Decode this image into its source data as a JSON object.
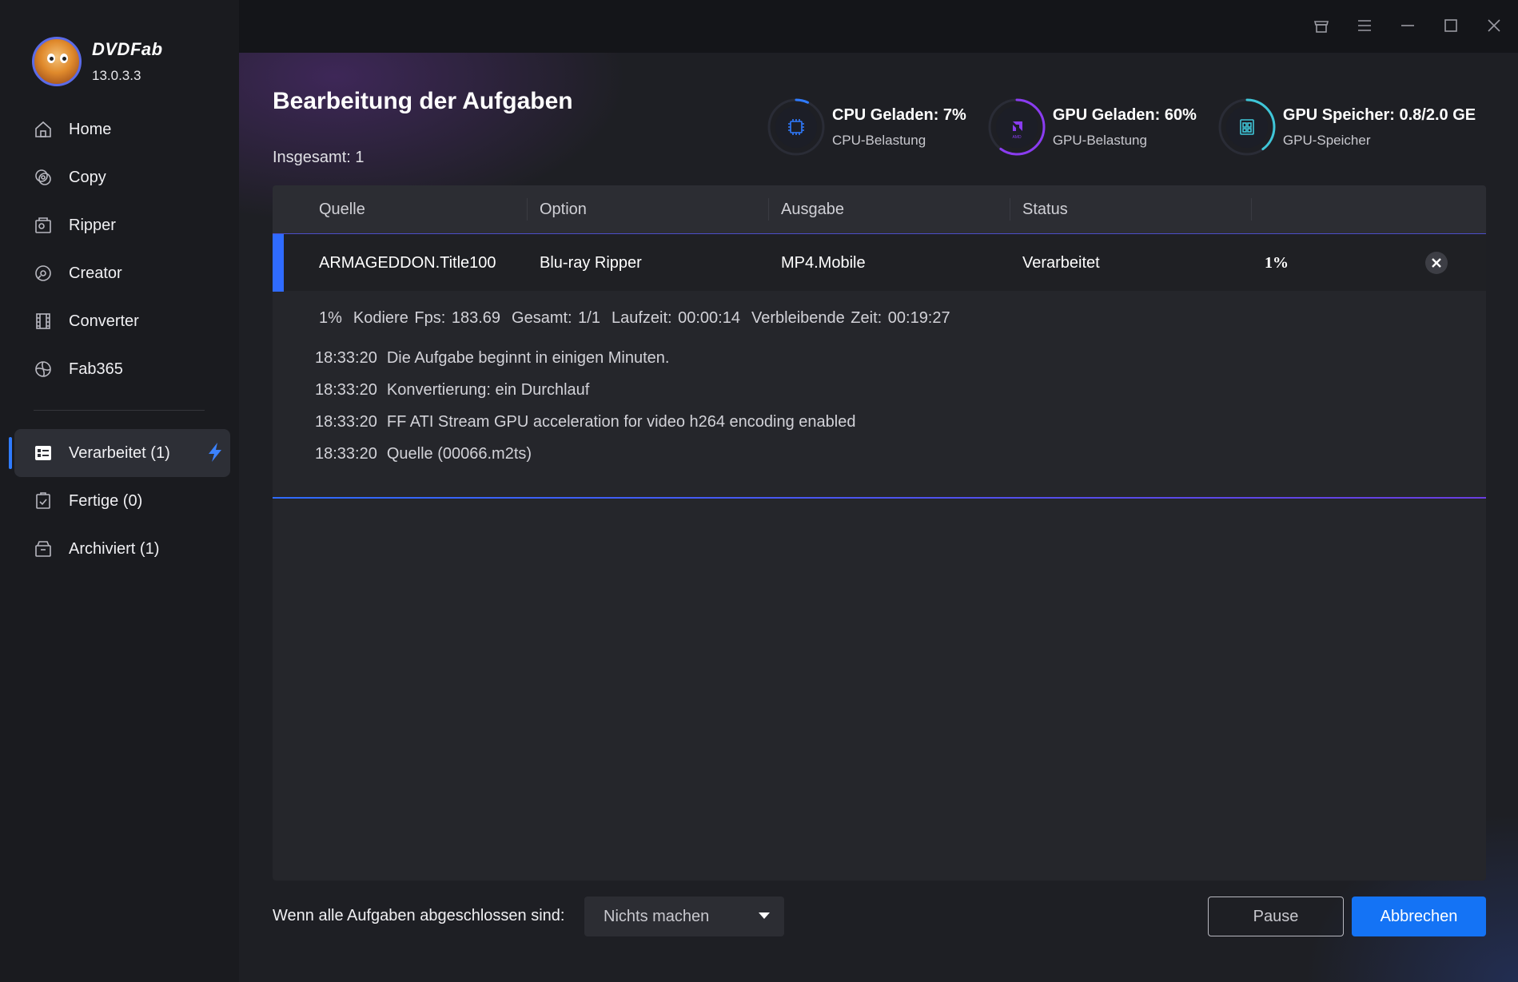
{
  "app": {
    "brand": "DVDFab",
    "version": "13.0.3.3"
  },
  "nav": {
    "items": [
      {
        "label": "Home",
        "icon": "home-icon"
      },
      {
        "label": "Copy",
        "icon": "copy-icon"
      },
      {
        "label": "Ripper",
        "icon": "ripper-icon"
      },
      {
        "label": "Creator",
        "icon": "creator-icon"
      },
      {
        "label": "Converter",
        "icon": "converter-icon"
      },
      {
        "label": "Fab365",
        "icon": "fab365-icon"
      }
    ],
    "tasks": [
      {
        "label": "Verarbeitet (1)",
        "icon": "task-list-icon",
        "active": true
      },
      {
        "label": "Fertige (0)",
        "icon": "clipboard-check-icon",
        "active": false
      },
      {
        "label": "Archiviert (1)",
        "icon": "archive-icon",
        "active": false
      }
    ]
  },
  "page": {
    "title": "Bearbeitung der Aufgaben",
    "total": "Insgesamt: 1"
  },
  "stats": {
    "cpu": {
      "title": "CPU Geladen: 7%",
      "sub": "CPU-Belastung",
      "value": 7,
      "color": "#2f7bff"
    },
    "gpu": {
      "title": "GPU Geladen: 60%",
      "sub": "GPU-Belastung",
      "value": 60,
      "color": "#8a3cf0",
      "chip_label": "AMD"
    },
    "mem": {
      "title": "GPU Speicher: 0.8/2.0 GE",
      "sub": "GPU-Speicher",
      "value": 40,
      "color": "#3fc6d8"
    }
  },
  "table": {
    "headers": [
      "Quelle",
      "Option",
      "Ausgabe",
      "Status"
    ],
    "row": {
      "source": "ARMAGEDDON.Title100",
      "option": "Blu-ray Ripper",
      "output": "MP4.Mobile",
      "status": "Verarbeitet",
      "percent": "1%"
    },
    "detail": {
      "progress": "1%",
      "fps": "Kodiere Fps: 183.69",
      "total": "Gesamt: 1/1",
      "runtime": "Laufzeit: 00:00:14",
      "remaining": "Verbleibende Zeit: 00:19:27",
      "logs": [
        {
          "time": "18:33:20",
          "text": "Die Aufgabe beginnt in einigen Minuten."
        },
        {
          "time": "18:33:20",
          "text": "Konvertierung: ein Durchlauf"
        },
        {
          "time": "18:33:20",
          "text": "FF ATI Stream GPU acceleration for video h264 encoding enabled"
        },
        {
          "time": "18:33:20",
          "text": "Quelle (00066.m2ts)"
        }
      ]
    }
  },
  "footer": {
    "label": "Wenn alle Aufgaben abgeschlossen sind:",
    "select_value": "Nichts machen",
    "pause": "Pause",
    "cancel": "Abbrechen"
  },
  "colors": {
    "accent": "#1473f5",
    "sidebar": "#1a1b1f",
    "panel": "#25262b"
  }
}
